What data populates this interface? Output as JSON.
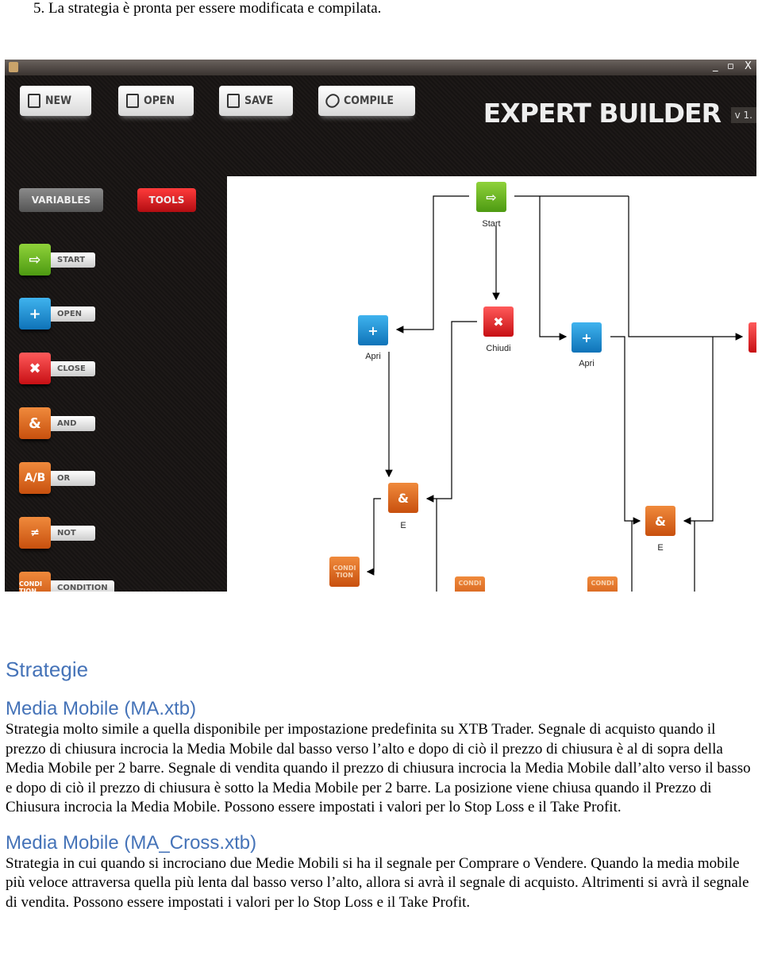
{
  "step": "5.   La strategia è pronta per essere modificata e compilata.",
  "app": {
    "window_controls": [
      "_",
      "▫",
      "X"
    ],
    "toolbar": [
      {
        "label": "NEW",
        "icon": "file-icon"
      },
      {
        "label": "OPEN",
        "icon": "open-file-icon"
      },
      {
        "label": "SAVE",
        "icon": "floppy-icon"
      },
      {
        "label": "COMPILE",
        "icon": "link-icon"
      }
    ],
    "brand": "EXPERT BUILDER",
    "version": "v 1.",
    "tabs": {
      "variables": "VARIABLES",
      "tools": "TOOLS"
    },
    "colors": {
      "green": "#5fae1c",
      "blue": "#1a8fd6",
      "red": "#e0161c",
      "orange": "#e0661f",
      "tools_tab": "#d9141a"
    },
    "tools": [
      {
        "label": "START",
        "glyph": "⇨",
        "color": "green"
      },
      {
        "label": "OPEN",
        "glyph": "+",
        "color": "blue"
      },
      {
        "label": "CLOSE",
        "glyph": "✖",
        "color": "red"
      },
      {
        "label": "AND",
        "glyph": "&",
        "color": "orange"
      },
      {
        "label": "OR",
        "glyph": "A/B",
        "color": "orange"
      },
      {
        "label": "NOT",
        "glyph": "≠",
        "color": "orange"
      },
      {
        "label": "CONDITION",
        "glyph": "CONDI TION",
        "color": "orange"
      }
    ],
    "diagram": {
      "nodes": {
        "start": "Start",
        "open1": "Apri",
        "close1": "Chiudi",
        "open2": "Apri",
        "close2": "C",
        "and1": "E",
        "and2": "E",
        "cond_glyph": "CONDI TION",
        "cond_cut": "CONDI"
      }
    }
  },
  "section_title": "Strategie",
  "strategies": [
    {
      "title": "Media Mobile (MA.xtb)",
      "text": "Strategia molto simile a quella disponibile per impostazione predefinita su XTB Trader. Segnale di acquisto quando il prezzo di chiusura incrocia la Media Mobile dal basso verso l’alto e dopo di ciò il prezzo di chiusura è al di sopra della Media Mobile per 2 barre. Segnale di vendita quando il prezzo di chiusura incrocia la Media Mobile dall’alto verso il basso e dopo di ciò il prezzo di chiusura è sotto la Media Mobile per 2 barre. La posizione viene chiusa quando il Prezzo di Chiusura incrocia la Media Mobile. Possono essere impostati i valori per lo Stop Loss e il Take Profit."
    },
    {
      "title": "Media Mobile (MA_Cross.xtb)",
      "text": "Strategia in cui quando si incrociano due Medie Mobili si ha il segnale per Comprare o Vendere. Quando la media mobile più veloce attraversa quella più lenta dal basso verso l’alto, allora si avrà il segnale di acquisto. Altrimenti si avrà il segnale di vendita. Possono essere impostati i valori per lo Stop Loss e il Take Profit."
    }
  ]
}
